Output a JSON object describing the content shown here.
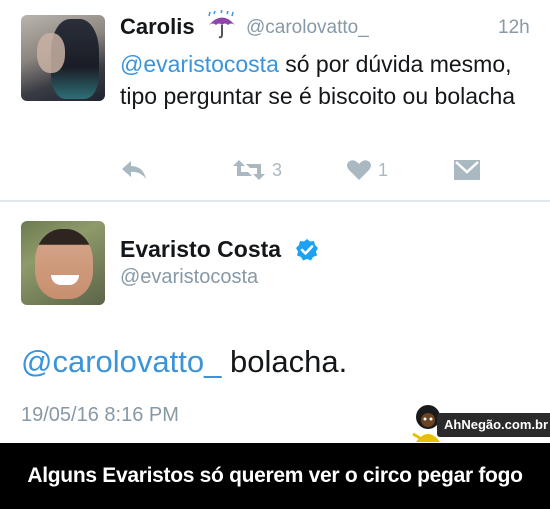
{
  "reply_tweet": {
    "author_name": "Carolis",
    "name_emoji_icon": "umbrella-with-rain-icon",
    "handle": "@carolovatto_",
    "time": "12h",
    "mention": "@evaristocosta",
    "text_rest": " só por dúvida mesmo, tipo perguntar se é biscoito ou bolacha",
    "actions": {
      "reply_icon": "reply-icon",
      "retweet_icon": "retweet-icon",
      "retweet_count": "3",
      "like_icon": "heart-icon",
      "like_count": "1",
      "message_icon": "envelope-icon"
    }
  },
  "main_tweet": {
    "author_name": "Evaristo Costa",
    "verified_icon": "verified-badge-icon",
    "handle": "@evaristocosta",
    "mention": "@carolovatto_",
    "text_rest": " bolacha.",
    "timestamp": "19/05/16 8:16 PM"
  },
  "watermark": {
    "text": "AhNegão.com.br"
  },
  "caption": "Alguns Evaristos só querem ver o circo pegar fogo",
  "colors": {
    "link": "#3b94d9",
    "muted": "#8899a6",
    "icon": "#aab8c2",
    "verified": "#1da1f2",
    "caption_bg": "#000000"
  }
}
